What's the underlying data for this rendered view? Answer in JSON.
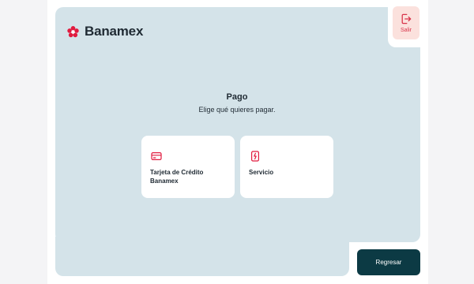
{
  "brand": {
    "name": "Banamex",
    "accent": "#e11b3f"
  },
  "header": {
    "exit_label": "Salir",
    "exit_icon": "logout-icon"
  },
  "main": {
    "title": "Pago",
    "subtitle": "Elige qué quieres pagar.",
    "options": [
      {
        "label": "Tarjeta de Crédito Banamex",
        "icon": "credit-card-icon"
      },
      {
        "label": "Servicio",
        "icon": "receipt-icon"
      }
    ]
  },
  "footer": {
    "back_label": "Regresar"
  },
  "colors": {
    "panel": "#d4e3e9",
    "primary_button": "#0c3a44",
    "exit_bg": "#fbe1dd"
  }
}
